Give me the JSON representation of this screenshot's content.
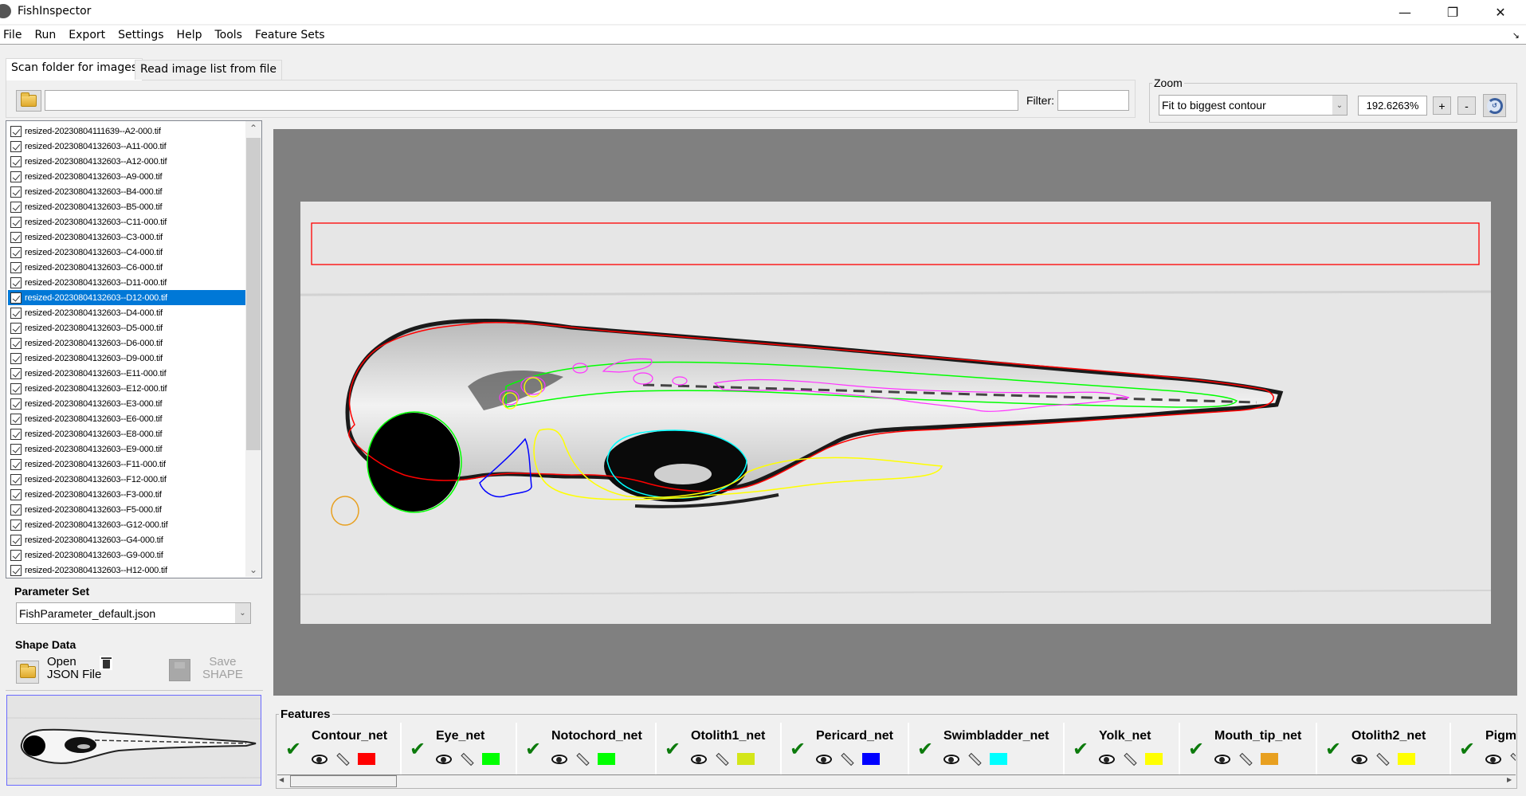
{
  "window": {
    "title": "FishInspector",
    "controls": {
      "minimize": "—",
      "maximize": "❐",
      "close": "✕"
    }
  },
  "menu": [
    "File",
    "Run",
    "Export",
    "Settings",
    "Help",
    "Tools",
    "Feature Sets"
  ],
  "menu_corner_icon": "↘",
  "tabs": [
    {
      "label": "Scan folder for images",
      "active": true
    },
    {
      "label": "Read image list from file",
      "active": false
    }
  ],
  "folder_bar": {
    "path_value": "",
    "filter_label": "Filter:",
    "filter_value": ""
  },
  "zoom": {
    "group_label": "Zoom",
    "mode": "Fit to biggest contour",
    "value": "192.6263%",
    "plus_label": "+",
    "minus_label": "-",
    "reset_icon": "reset-view-icon"
  },
  "file_list": {
    "selected_index": 11,
    "items": [
      "resized-20230804111639--A2-000.tif",
      "resized-20230804132603--A11-000.tif",
      "resized-20230804132603--A12-000.tif",
      "resized-20230804132603--A9-000.tif",
      "resized-20230804132603--B4-000.tif",
      "resized-20230804132603--B5-000.tif",
      "resized-20230804132603--C11-000.tif",
      "resized-20230804132603--C3-000.tif",
      "resized-20230804132603--C4-000.tif",
      "resized-20230804132603--C6-000.tif",
      "resized-20230804132603--D11-000.tif",
      "resized-20230804132603--D12-000.tif",
      "resized-20230804132603--D4-000.tif",
      "resized-20230804132603--D5-000.tif",
      "resized-20230804132603--D6-000.tif",
      "resized-20230804132603--D9-000.tif",
      "resized-20230804132603--E11-000.tif",
      "resized-20230804132603--E12-000.tif",
      "resized-20230804132603--E3-000.tif",
      "resized-20230804132603--E6-000.tif",
      "resized-20230804132603--E8-000.tif",
      "resized-20230804132603--E9-000.tif",
      "resized-20230804132603--F11-000.tif",
      "resized-20230804132603--F12-000.tif",
      "resized-20230804132603--F3-000.tif",
      "resized-20230804132603--F5-000.tif",
      "resized-20230804132603--G12-000.tif",
      "resized-20230804132603--G4-000.tif",
      "resized-20230804132603--G9-000.tif",
      "resized-20230804132603--H12-000.tif"
    ]
  },
  "parameter_set": {
    "label": "Parameter Set",
    "selected": "FishParameter_default.json"
  },
  "shape_data": {
    "label": "Shape Data",
    "open_label_line1": "Open",
    "open_label_line2": "JSON File",
    "save_label_line1": "Save",
    "save_label_line2": "SHAPE",
    "save_enabled": false
  },
  "features": {
    "label": "Features",
    "items": [
      {
        "name": "Contour_net",
        "color": "#ff0000",
        "checked": true
      },
      {
        "name": "Eye_net",
        "color": "#00ff00",
        "checked": true
      },
      {
        "name": "Notochord_net",
        "color": "#00ff00",
        "checked": true
      },
      {
        "name": "Otolith1_net",
        "color": "#d4e619",
        "checked": true
      },
      {
        "name": "Pericard_net",
        "color": "#0000ff",
        "checked": true
      },
      {
        "name": "Swimbladder_net",
        "color": "#00ffff",
        "checked": true
      },
      {
        "name": "Yolk_net",
        "color": "#ffff00",
        "checked": true
      },
      {
        "name": "Mouth_tip_net",
        "color": "#e8a020",
        "checked": true
      },
      {
        "name": "Otolith2_net",
        "color": "#ffff00",
        "checked": true
      },
      {
        "name": "Pigmer",
        "color": "",
        "checked": true
      }
    ]
  },
  "overlay_colors": {
    "contour": "#ff0000",
    "eye": "#00ff00",
    "notochord": "#00ff00",
    "otolith1": "#d4e619",
    "pericard": "#0000ff",
    "swimbladder": "#00ffff",
    "yolk": "#ffff00",
    "mouth_tip": "#e8a020",
    "otolith2": "#ffff00",
    "pigment": "#ff33ff",
    "background_roi": "#ff0000"
  }
}
